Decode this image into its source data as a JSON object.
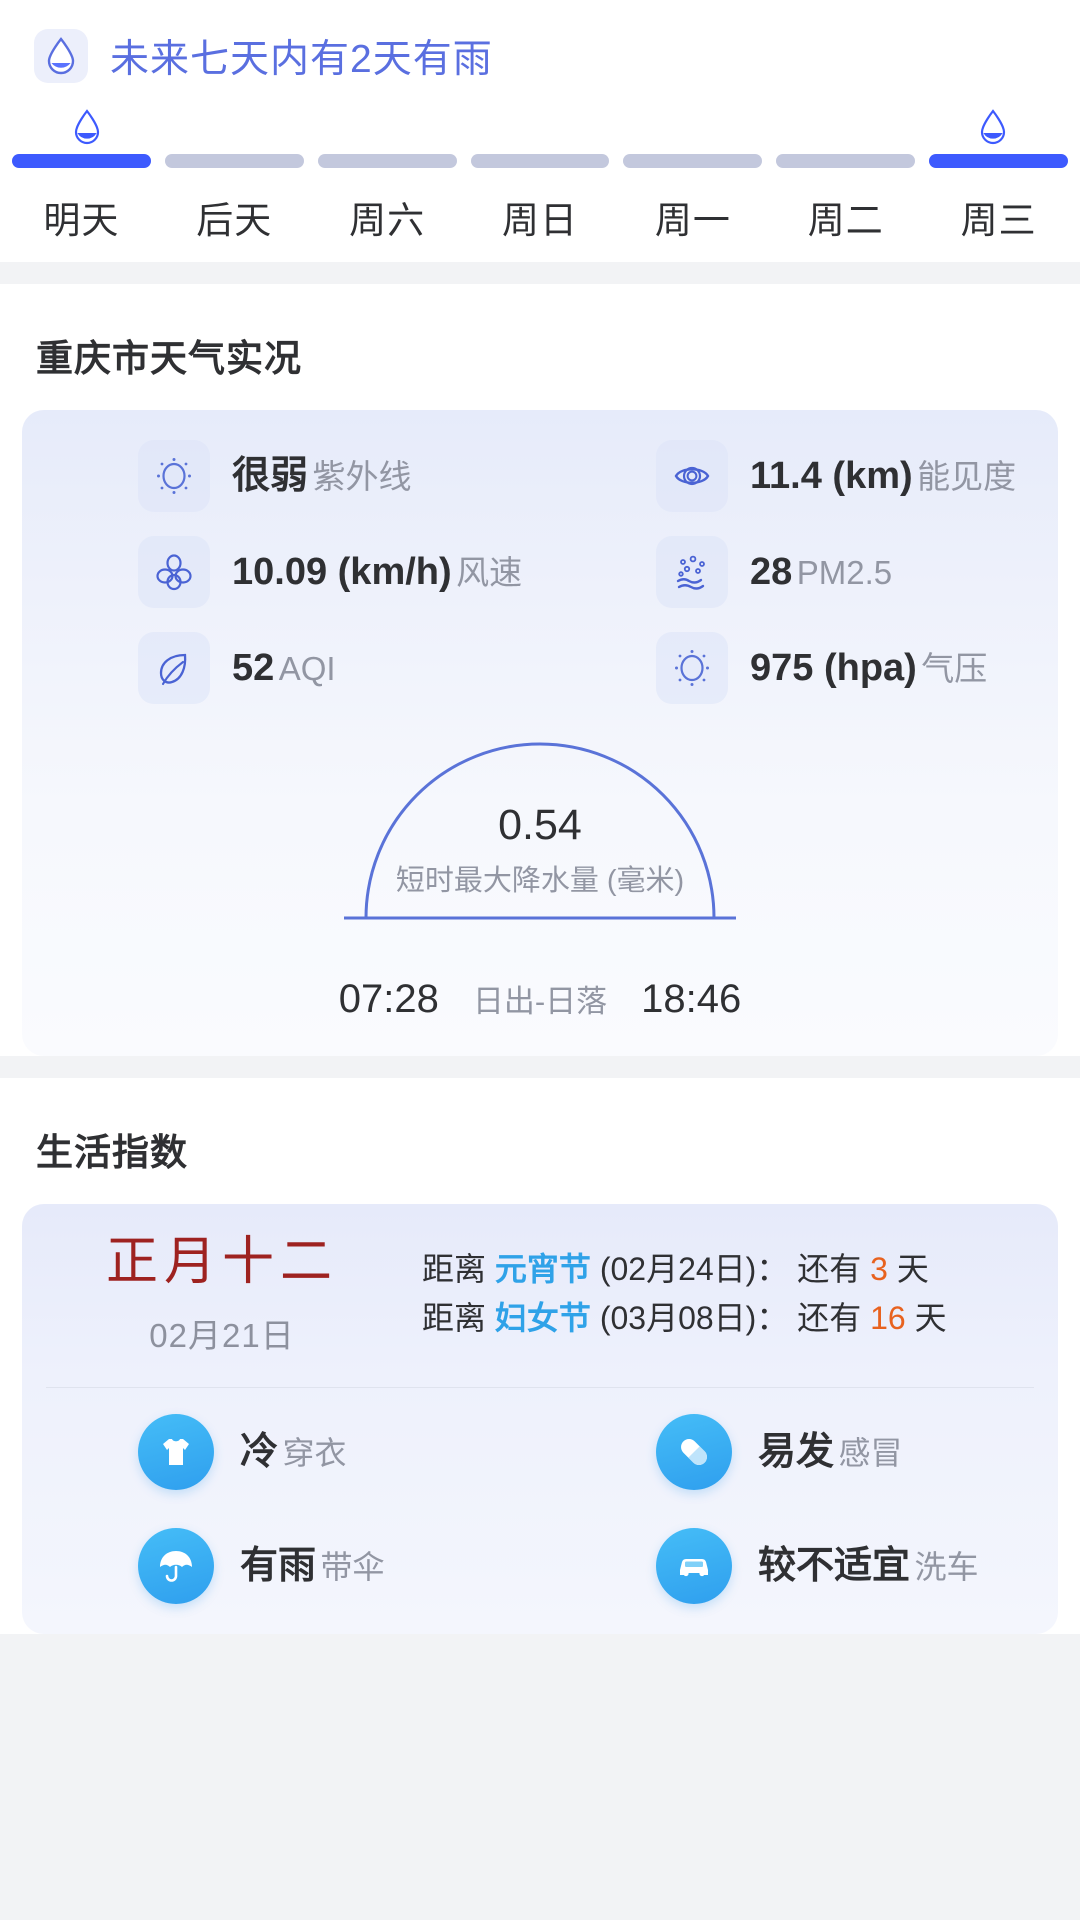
{
  "forecast": {
    "banner_icon": "rain-drop-icon",
    "banner_text": "未来七天内有2天有雨",
    "accent_color": "#5a6fe0",
    "bar_active_color": "#3d5afe",
    "bar_inactive_color": "#c3c8dd",
    "days": [
      {
        "label": "明天",
        "rain": true,
        "active": true
      },
      {
        "label": "后天",
        "rain": false,
        "active": false
      },
      {
        "label": "周六",
        "rain": false,
        "active": false
      },
      {
        "label": "周日",
        "rain": false,
        "active": false
      },
      {
        "label": "周一",
        "rain": false,
        "active": false
      },
      {
        "label": "周二",
        "rain": false,
        "active": false
      },
      {
        "label": "周三",
        "rain": true,
        "active": true
      }
    ]
  },
  "current": {
    "title": "重庆市天气实况",
    "metrics": [
      {
        "icon": "uv-sun-icon",
        "value": "很弱",
        "label": "紫外线"
      },
      {
        "icon": "eye-visibility-icon",
        "value": "11.4 (km)",
        "label": "能见度"
      },
      {
        "icon": "fan-wind-icon",
        "value": "10.09 (km/h)",
        "label": "风速"
      },
      {
        "icon": "particles-pm-icon",
        "value": "28",
        "label": "PM2.5"
      },
      {
        "icon": "leaf-aqi-icon",
        "value": "52",
        "label": "AQI"
      },
      {
        "icon": "pressure-sun-icon",
        "value": "975 (hpa)",
        "label": "气压"
      }
    ],
    "arc": {
      "precip_value": "0.54",
      "precip_label": "短时最大降水量 (毫米)",
      "sunrise": "07:28",
      "separator": "日出-日落",
      "sunset": "18:46",
      "arc_color": "#5a73d8"
    }
  },
  "life": {
    "title": "生活指数",
    "calendar": {
      "lunar": "正月十二",
      "lunar_color": "#9e2220",
      "solar": "02月21日"
    },
    "festivals": [
      {
        "prefix": "距离",
        "name": "元宵节",
        "date": "(02月24日)：",
        "middle": "还有",
        "days": "3",
        "suffix": "天"
      },
      {
        "prefix": "距离",
        "name": "妇女节",
        "date": "(03月08日)：",
        "middle": "还有",
        "days": "16",
        "suffix": "天"
      }
    ],
    "indices": [
      {
        "icon": "tshirt-icon",
        "value": "冷",
        "label": "穿衣"
      },
      {
        "icon": "capsule-icon",
        "value": "易发",
        "label": "感冒"
      },
      {
        "icon": "umbrella-icon",
        "value": "有雨",
        "label": "带伞"
      },
      {
        "icon": "car-icon",
        "value": "较不适宜",
        "label": "洗车"
      }
    ]
  }
}
